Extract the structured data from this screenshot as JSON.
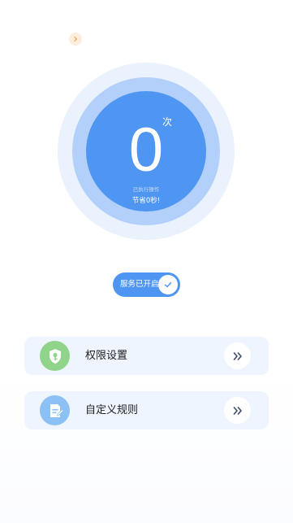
{
  "colors": {
    "accent": "#4f95f2",
    "ring_mid": "#b3d0fb",
    "ring_outer": "#eaf2fe",
    "card_bg": "#eef5fe",
    "permission_icon": "#8fd48a",
    "rule_icon": "#8cc1f5"
  },
  "top_hint": {
    "icon": "chevron-right-icon"
  },
  "counter": {
    "value": "0",
    "unit": "次",
    "executed_label": "已执行操作",
    "saved_label": "节省0秒!"
  },
  "service": {
    "label": "服务已开启",
    "enabled": true,
    "icon": "check-icon"
  },
  "cards": [
    {
      "label": "权限设置",
      "icon": "shield-key-icon",
      "arrow_icon": "double-chevron-right-icon"
    },
    {
      "label": "自定义规则",
      "icon": "document-edit-icon",
      "arrow_icon": "double-chevron-right-icon"
    }
  ]
}
